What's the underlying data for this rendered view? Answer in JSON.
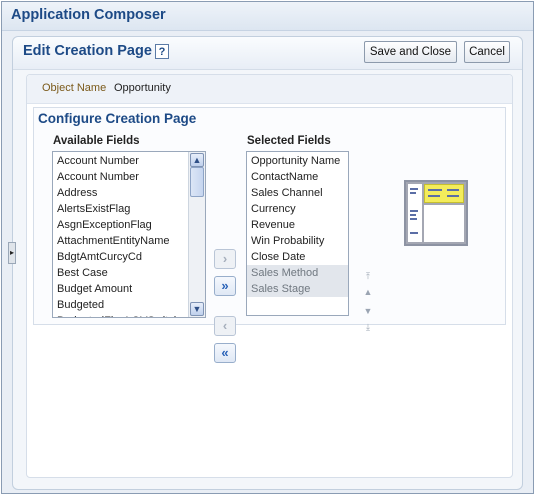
{
  "app": {
    "title": "Application Composer"
  },
  "page": {
    "title": "Edit Creation Page",
    "help_glyph": "?",
    "save_close_label": "Save and Close",
    "cancel_label": "Cancel"
  },
  "object": {
    "label": "Object Name",
    "value": "Opportunity"
  },
  "configure": {
    "title": "Configure Creation Page",
    "available_header": "Available Fields",
    "selected_header": "Selected Fields",
    "available_fields": [
      "Account Number",
      "Account Number",
      "Address",
      "AlertsExistFlag",
      "AsgnExceptionFlag",
      "AttachmentEntityName",
      "BdgtAmtCurcyCd",
      "Best Case",
      "Budget Amount",
      "Budgeted",
      "BudgetedFlagLOVSwitcher"
    ],
    "selected_fields": [
      "Opportunity Name",
      "ContactName",
      "Sales Channel",
      "Currency",
      "Revenue",
      "Win Probability",
      "Close Date",
      "Sales Method",
      "Sales Stage"
    ],
    "locked_selected": [
      "Sales Method",
      "Sales Stage"
    ],
    "shuttle_icons": {
      "move": "chevron-right-icon",
      "move_all": "double-chevron-right-icon",
      "remove": "chevron-left-icon",
      "remove_all": "double-chevron-left-icon"
    },
    "reorder_icons": [
      "move-top-icon",
      "move-up-icon",
      "move-down-icon",
      "move-bottom-icon"
    ],
    "accent_color": "#2a63b8"
  },
  "colors": {
    "title_text": "#1d4a86",
    "label_text": "#7b5a1a",
    "preview_highlight": "#f3ec5b"
  }
}
